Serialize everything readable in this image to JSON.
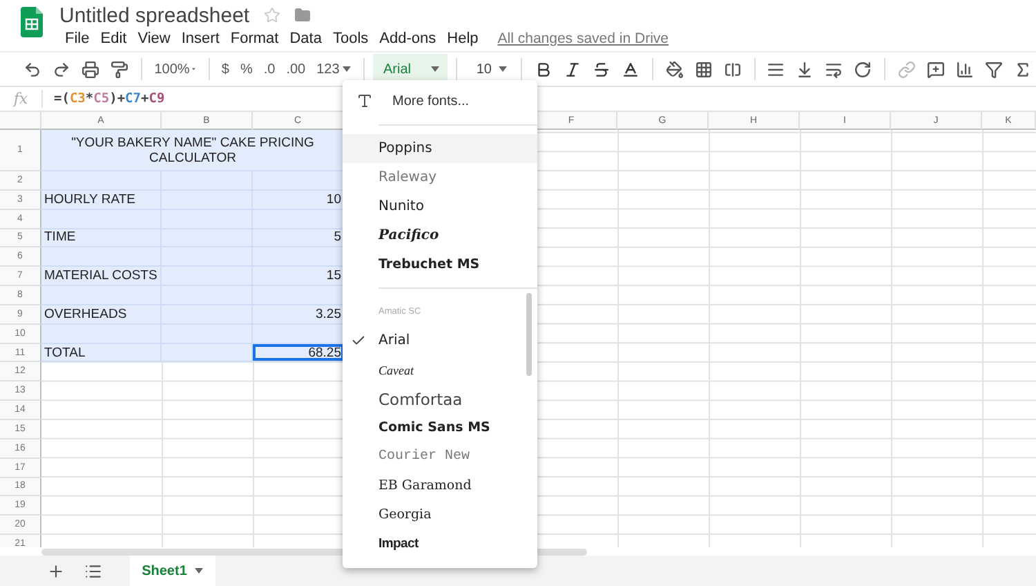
{
  "doc": {
    "title": "Untitled spreadsheet",
    "starred": false,
    "save_status": "All changes saved in Drive"
  },
  "menu": [
    "File",
    "Edit",
    "View",
    "Insert",
    "Format",
    "Data",
    "Tools",
    "Add-ons",
    "Help"
  ],
  "toolbar": {
    "zoom": "100%",
    "currency": "$",
    "percent": "%",
    "decrease_decimals": ".0",
    "increase_decimals": ".00",
    "number_format": "123",
    "font": {
      "value": "Arial",
      "open": true
    },
    "font_size": "10"
  },
  "formula_bar": {
    "label": "fx",
    "tokens": [
      {
        "text": "=(",
        "color": "#444444"
      },
      {
        "text": "C3",
        "color": "#e69138"
      },
      {
        "text": "*",
        "color": "#444444"
      },
      {
        "text": "C5",
        "color": "#c27ba0"
      },
      {
        "text": ")+",
        "color": "#444444"
      },
      {
        "text": "C7",
        "color": "#3d85c6"
      },
      {
        "text": "+",
        "color": "#444444"
      },
      {
        "text": "C9",
        "color": "#a64d79"
      }
    ]
  },
  "columns": [
    {
      "label": "A"
    },
    {
      "label": "B"
    },
    {
      "label": "C"
    },
    {},
    {},
    {
      "label": "F"
    },
    {
      "label": "G"
    },
    {
      "label": "H"
    },
    {
      "label": "I"
    },
    {
      "label": "J"
    },
    {
      "label": "K"
    }
  ],
  "rows": [
    {
      "number": "1",
      "title": "\"YOUR BAKERY NAME\" CAKE PRICING CALCULATOR",
      "selected": true
    },
    {
      "number": "2",
      "selected": true
    },
    {
      "number": "3",
      "label": "HOURLY RATE",
      "value": "10",
      "selected": true
    },
    {
      "number": "4",
      "selected": true
    },
    {
      "number": "5",
      "label": "TIME",
      "value": "5",
      "selected": true
    },
    {
      "number": "6",
      "selected": true
    },
    {
      "number": "7",
      "label": "MATERIAL COSTS",
      "value": "15",
      "selected": true
    },
    {
      "number": "8",
      "selected": true
    },
    {
      "number": "9",
      "label": "OVERHEADS",
      "value": "3.25",
      "selected": true
    },
    {
      "number": "10",
      "selected": true
    },
    {
      "number": "11",
      "label": "TOTAL",
      "value": "68.25",
      "selected": true,
      "active": true
    },
    {
      "number": "12",
      "selected": false
    },
    {
      "number": "13",
      "selected": false
    },
    {
      "number": "14",
      "selected": false
    },
    {
      "number": "15",
      "selected": false
    },
    {
      "number": "16",
      "selected": false
    },
    {
      "number": "17",
      "selected": false
    },
    {
      "number": "18",
      "selected": false
    },
    {
      "number": "19",
      "selected": false
    },
    {
      "number": "20",
      "selected": false
    },
    {
      "number": "21",
      "selected": false
    }
  ],
  "font_menu": {
    "more": "More fonts...",
    "sections": [
      [
        {
          "name": "Poppins",
          "kind": "sans",
          "highlighted": true,
          "selected": false
        },
        {
          "name": "Raleway",
          "kind": "light",
          "highlighted": false,
          "selected": false
        },
        {
          "name": "Nunito",
          "kind": "sans",
          "highlighted": false,
          "selected": false
        },
        {
          "name": "Pacifico",
          "kind": "script",
          "highlighted": false,
          "selected": false
        },
        {
          "name": "Trebuchet MS",
          "kind": "bold",
          "highlighted": false,
          "selected": false
        }
      ],
      [
        {
          "name": "Amatic SC",
          "kind": "thin",
          "highlighted": false,
          "selected": false
        },
        {
          "name": "Arial",
          "kind": "sans",
          "highlighted": false,
          "selected": true
        },
        {
          "name": "Caveat",
          "kind": "handwriting",
          "highlighted": false,
          "selected": false
        },
        {
          "name": "Comfortaa",
          "kind": "rounded",
          "highlighted": false,
          "selected": false
        },
        {
          "name": "Comic Sans MS",
          "kind": "comic",
          "highlighted": false,
          "selected": false
        },
        {
          "name": "Courier New",
          "kind": "mono",
          "highlighted": false,
          "selected": false
        },
        {
          "name": "EB Garamond",
          "kind": "serif",
          "highlighted": false,
          "selected": false
        },
        {
          "name": "Georgia",
          "kind": "serif",
          "highlighted": false,
          "selected": false
        },
        {
          "name": "Impact",
          "kind": "heavy",
          "highlighted": false,
          "selected": false
        }
      ]
    ]
  },
  "sheets": [
    {
      "name": "Sheet1",
      "selected": true
    }
  ]
}
